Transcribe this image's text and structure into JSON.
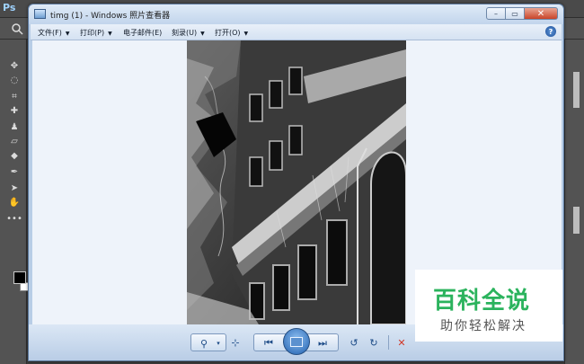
{
  "photoshop": {
    "logo": "Ps",
    "tools": [
      {
        "name": "move-tool-icon",
        "glyph": "✥"
      },
      {
        "name": "lasso-tool-icon",
        "glyph": "◌"
      },
      {
        "name": "crop-tool-icon",
        "glyph": "⌗"
      },
      {
        "name": "healing-brush-icon",
        "glyph": "✚"
      },
      {
        "name": "stamp-tool-icon",
        "glyph": "♟"
      },
      {
        "name": "eraser-tool-icon",
        "glyph": "▱"
      },
      {
        "name": "blur-tool-icon",
        "glyph": "◆"
      },
      {
        "name": "pen-tool-icon",
        "glyph": "✒"
      },
      {
        "name": "path-select-icon",
        "glyph": "➤"
      },
      {
        "name": "hand-tool-icon",
        "glyph": "✋"
      },
      {
        "name": "more-tools-icon",
        "glyph": "•••"
      }
    ]
  },
  "viewer": {
    "title": "timg (1) - Windows 照片查看器",
    "window_buttons": {
      "minimize": "–",
      "maximize": "▭",
      "close": "✕"
    },
    "menu": [
      {
        "label": "文件(F)"
      },
      {
        "label": "打印(P)"
      },
      {
        "label": "电子邮件(E)"
      },
      {
        "label": "刻录(U)"
      },
      {
        "label": "打开(O)"
      }
    ],
    "help": "?",
    "toolbar": {
      "zoom": "⚲",
      "fit": "⊹",
      "prev": "⏮",
      "next": "⏭",
      "rotate_ccw": "↺",
      "rotate_cw": "↻",
      "delete": "✕"
    }
  },
  "watermark": {
    "logo": "百科全说",
    "tagline": "助你轻松解决"
  },
  "colors": {
    "ps_dark": "#535353",
    "viewer_frame": "#b8cde6",
    "canvas": "#eef3fa",
    "watermark_green": "#2bb35d",
    "delete_red": "#d03a2a"
  }
}
